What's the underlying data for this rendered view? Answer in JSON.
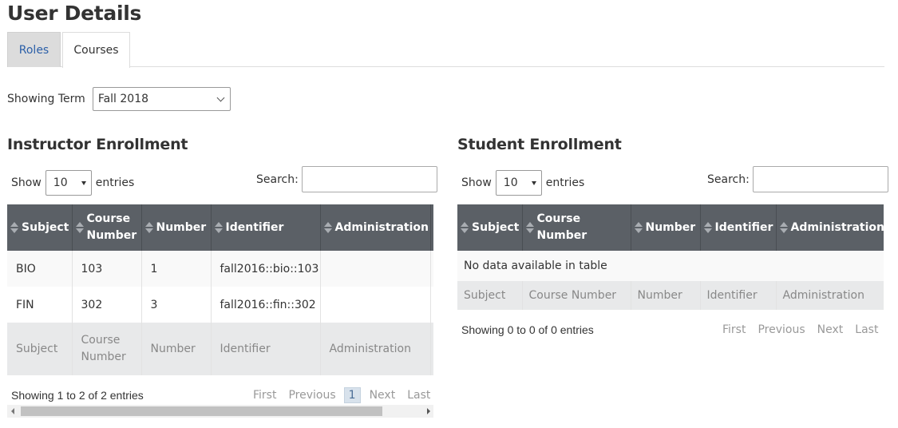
{
  "page": {
    "title": "User Details"
  },
  "tabs": [
    {
      "label": "Roles",
      "active": true
    },
    {
      "label": "Courses",
      "active": false
    }
  ],
  "term": {
    "label": "Showing Term",
    "selected": "Fall 2018"
  },
  "instructor": {
    "title": "Instructor Enrollment",
    "length": {
      "show": "Show",
      "value": "10",
      "entries": "entries"
    },
    "search": {
      "label": "Search:",
      "value": ""
    },
    "columns": [
      "Subject",
      "Course Number",
      "Number",
      "Identifier",
      "Administration"
    ],
    "rows": [
      {
        "subject": "BIO",
        "course_number": "103",
        "number": "1",
        "identifier": "fall2016::bio::103",
        "administration": ""
      },
      {
        "subject": "FIN",
        "course_number": "302",
        "number": "3",
        "identifier": "fall2016::fin::302",
        "administration": ""
      }
    ],
    "footer": [
      "Subject",
      "Course Number",
      "Number",
      "Identifier",
      "Administration"
    ],
    "info": "Showing 1 to 2 of 2 entries",
    "pager": {
      "first": "First",
      "previous": "Previous",
      "current": "1",
      "next": "Next",
      "last": "Last"
    }
  },
  "student": {
    "title": "Student Enrollment",
    "length": {
      "show": "Show",
      "value": "10",
      "entries": "entries"
    },
    "search": {
      "label": "Search:",
      "value": ""
    },
    "columns": [
      "Subject",
      "Course Number",
      "Number",
      "Identifier",
      "Administration"
    ],
    "empty": "No data available in table",
    "footer": [
      "Subject",
      "Course Number",
      "Number",
      "Identifier",
      "Administration"
    ],
    "info": "Showing 0 to 0 of 0 entries",
    "pager": {
      "first": "First",
      "previous": "Previous",
      "next": "Next",
      "last": "Last"
    }
  }
}
